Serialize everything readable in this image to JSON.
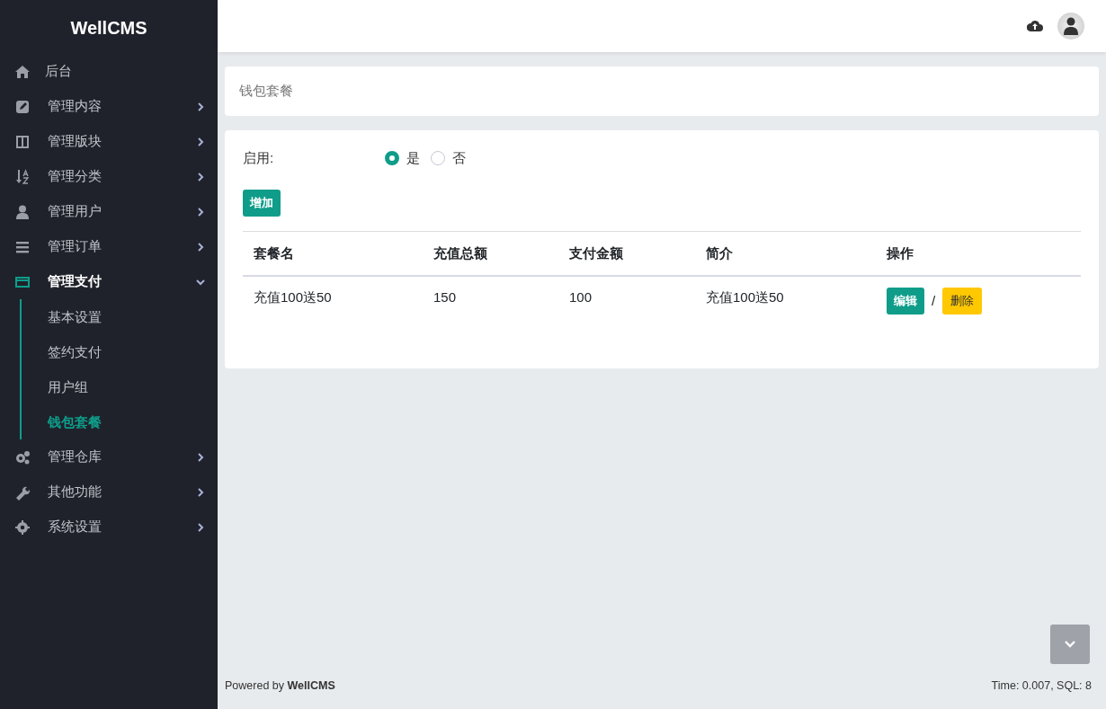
{
  "brand": "WellCMS",
  "sidebar": {
    "items": [
      {
        "label": "后台",
        "kind": "link",
        "selected": false
      },
      {
        "label": "管理内容",
        "kind": "menu",
        "expanded": false,
        "selected": false
      },
      {
        "label": "管理版块",
        "kind": "menu",
        "expanded": false,
        "selected": false
      },
      {
        "label": "管理分类",
        "kind": "menu",
        "expanded": false,
        "selected": false
      },
      {
        "label": "管理用户",
        "kind": "menu",
        "expanded": false,
        "selected": false
      },
      {
        "label": "管理订单",
        "kind": "menu",
        "expanded": false,
        "selected": false
      },
      {
        "label": "管理支付",
        "kind": "menu",
        "expanded": true,
        "selected": true,
        "children": [
          {
            "label": "基本设置",
            "selected": false
          },
          {
            "label": "签约支付",
            "selected": false
          },
          {
            "label": "用户组",
            "selected": false
          },
          {
            "label": "钱包套餐",
            "selected": true
          }
        ]
      },
      {
        "label": "管理仓库",
        "kind": "menu",
        "expanded": false,
        "selected": false
      },
      {
        "label": "其他功能",
        "kind": "menu",
        "expanded": false,
        "selected": false
      },
      {
        "label": "系统设置",
        "kind": "menu",
        "expanded": false,
        "selected": false
      }
    ]
  },
  "page_title": "钱包套餐",
  "enable": {
    "label": "启用:",
    "options": [
      {
        "label": "是",
        "selected": true
      },
      {
        "label": "否",
        "selected": false
      }
    ]
  },
  "add_button": "增加",
  "table": {
    "columns": [
      "套餐名",
      "充值总额",
      "支付金额",
      "简介",
      "操作"
    ],
    "rows": [
      {
        "cells": [
          "充值100送50",
          "150",
          "100",
          "充值100送50"
        ],
        "edit": "编辑",
        "separator": "/",
        "delete": "删除"
      }
    ]
  },
  "footer": {
    "powered": "Powered by **WellCMS**",
    "stats": "Time: 0.007, SQL: 8"
  }
}
